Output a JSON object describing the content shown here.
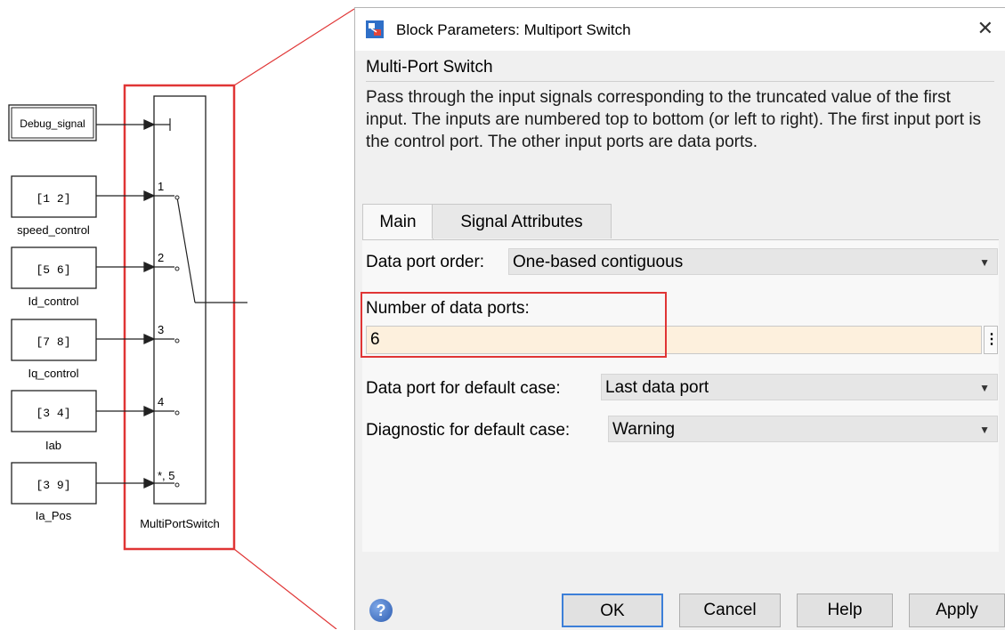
{
  "diagram": {
    "inputs": [
      {
        "value": "Debug_signal",
        "label": ""
      },
      {
        "value": "[1 2]",
        "label": "speed_control"
      },
      {
        "value": "[5 6]",
        "label": "Id_control"
      },
      {
        "value": "[7 8]",
        "label": "Iq_control"
      },
      {
        "value": "[3 4]",
        "label": "Iab"
      },
      {
        "value": "[3 9]",
        "label": "Ia_Pos"
      }
    ],
    "port_labels": [
      "1",
      "2",
      "3",
      "4",
      "*, 5"
    ],
    "block_label": "MultiPortSwitch",
    "highlight_color": "#e03535"
  },
  "dialog": {
    "title": "Block Parameters: Multiport Switch",
    "close_icon": "close-icon",
    "heading": "Multi-Port Switch",
    "description": "Pass through the input signals corresponding to the truncated value of the first input. The inputs are numbered top to bottom (or left to right). The first input port is the control port. The other input ports are data ports.",
    "tabs": [
      "Main",
      "Signal Attributes"
    ],
    "fields": {
      "data_port_order": {
        "label": "Data port order:",
        "value": "One-based contiguous"
      },
      "num_ports": {
        "label": "Number of data ports:",
        "value": "6"
      },
      "default_case": {
        "label": "Data port for default case:",
        "value": "Last data port"
      },
      "diagnostic": {
        "label": "Diagnostic for default case:",
        "value": "Warning"
      }
    },
    "buttons": {
      "ok": "OK",
      "cancel": "Cancel",
      "help": "Help",
      "apply": "Apply"
    },
    "input_bg": "#fdf0dd"
  }
}
